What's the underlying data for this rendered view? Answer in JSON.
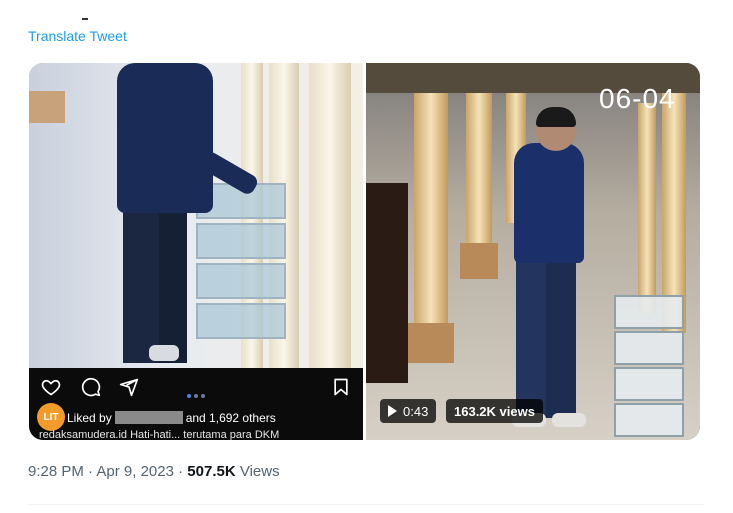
{
  "tweet": {
    "translate_label": "Translate Tweet",
    "time": "9:28 PM",
    "separator": "·",
    "date": "Apr 9, 2023",
    "views_count": "507.5K",
    "views_label": "Views"
  },
  "left_media": {
    "icons": [
      "heart-icon",
      "comment-icon",
      "share-icon",
      "bookmark-icon"
    ],
    "badge": "LIT",
    "liked_prefix": "Liked by",
    "liked_suffix": "and 1,692 others",
    "caption": "redaksamudera.id Hati-hati... terutama para DKM"
  },
  "right_media": {
    "date_overlay": "06-04",
    "duration": "0:43",
    "video_views": "163.2K views"
  },
  "colors": {
    "link": "#1d9bf0",
    "meta": "#536471",
    "ig_bar": "#0b0b0b"
  }
}
